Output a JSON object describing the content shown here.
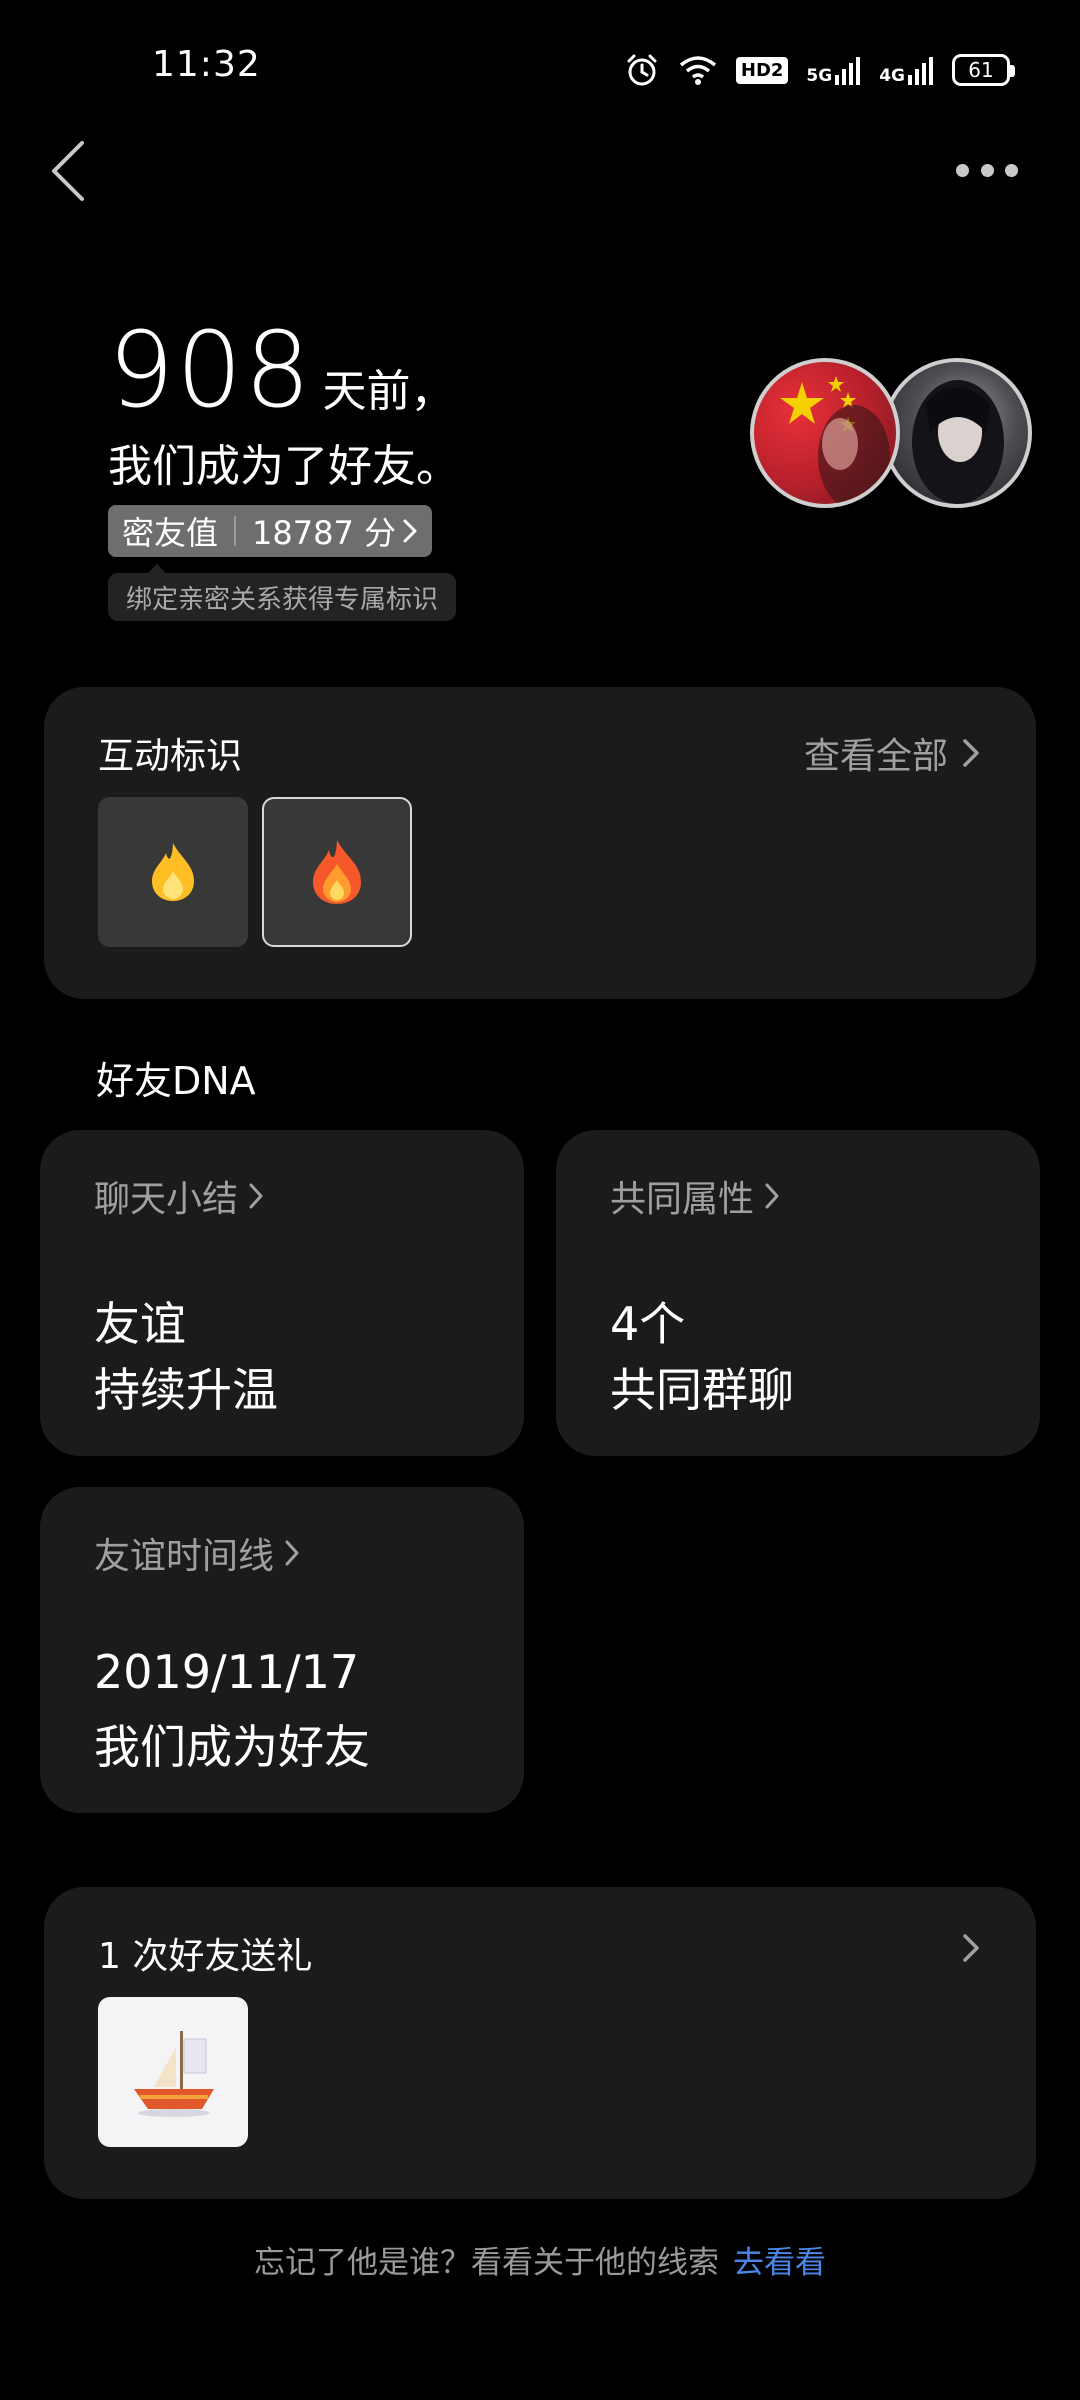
{
  "status_bar": {
    "time": "11:32",
    "hd_label": "HD2",
    "net1_label": "5G",
    "net2_label": "4G",
    "battery": "61"
  },
  "header": {
    "days": "908",
    "days_suffix": "天前，",
    "friend_text": "我们成为了好友。",
    "score_label": "密友值",
    "score_value": "18787 分",
    "tip": "绑定亲密关系获得专属标识"
  },
  "interaction_card": {
    "title": "互动标识",
    "view_all": "查看全部"
  },
  "dna": {
    "section_title": "好友DNA",
    "cards": [
      {
        "title": "聊天小结",
        "line1": "友谊",
        "line2": "持续升温"
      },
      {
        "title": "共同属性",
        "line1": "4个",
        "line2": "共同群聊"
      },
      {
        "title": "友谊时间线",
        "line1": "2019/11/17",
        "line2": "我们成为好友"
      }
    ]
  },
  "gift_card": {
    "title": "1 次好友送礼"
  },
  "footer": {
    "text": "忘记了他是谁？看看关于他的线索",
    "link": "去看看"
  },
  "colors": {
    "background": "#000000",
    "card": "#1b1b1b",
    "secondary_text": "#a0a0a0",
    "link": "#4d86e8"
  },
  "icons": [
    "alarm-icon",
    "wifi-icon",
    "signal-icon",
    "battery-icon",
    "back-arrow-icon",
    "more-icon",
    "chevron-right-icon",
    "flame-icon",
    "gift-boat-icon"
  ]
}
